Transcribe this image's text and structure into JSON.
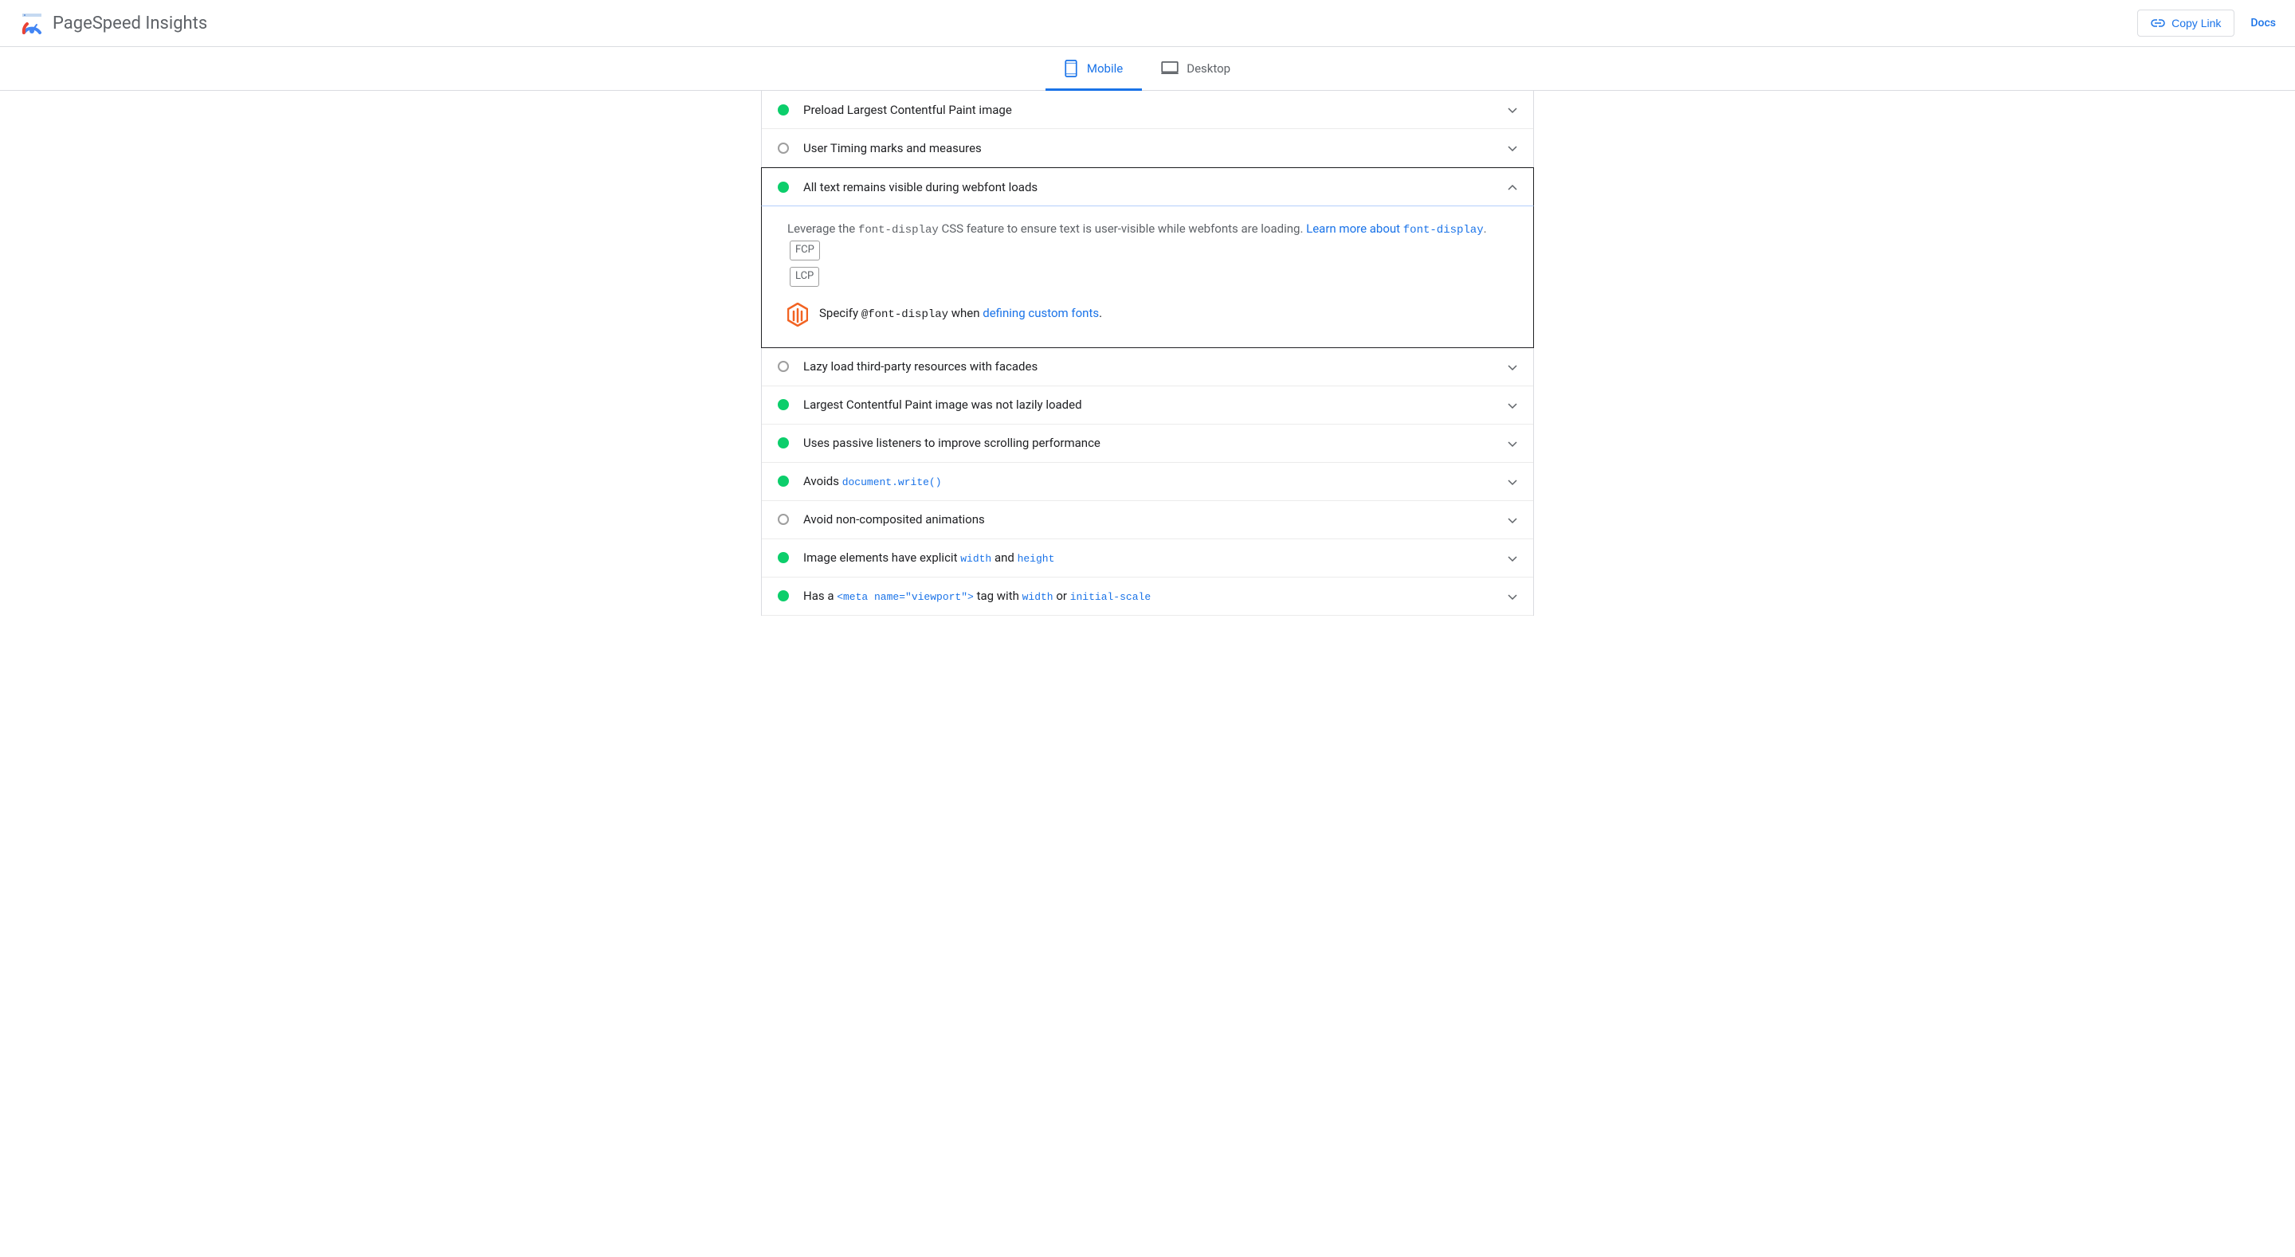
{
  "header": {
    "title": "PageSpeed Insights",
    "copy_link": "Copy Link",
    "docs": "Docs"
  },
  "tabs": {
    "mobile": "Mobile",
    "desktop": "Desktop"
  },
  "audits": [
    {
      "status": "pass",
      "title": "Preload Largest Contentful Paint image"
    },
    {
      "status": "neutral",
      "title": "User Timing marks and measures"
    },
    {
      "status": "pass",
      "title": "All text remains visible during webfont loads",
      "expanded": true
    },
    {
      "status": "neutral",
      "title": "Lazy load third-party resources with facades"
    },
    {
      "status": "pass",
      "title": "Largest Contentful Paint image was not lazily loaded"
    },
    {
      "status": "pass",
      "title": "Uses passive listeners to improve scrolling performance"
    },
    {
      "status": "pass",
      "title_parts": [
        {
          "t": "Avoids ",
          "c": false
        },
        {
          "t": "document.write()",
          "c": true
        }
      ]
    },
    {
      "status": "neutral",
      "title": "Avoid non-composited animations"
    },
    {
      "status": "pass",
      "title_parts": [
        {
          "t": "Image elements have explicit ",
          "c": false
        },
        {
          "t": "width",
          "c": true
        },
        {
          "t": " and ",
          "c": false
        },
        {
          "t": "height",
          "c": true
        }
      ]
    },
    {
      "status": "pass",
      "title_parts": [
        {
          "t": "Has a ",
          "c": false
        },
        {
          "t": "<meta name=\"viewport\">",
          "c": true
        },
        {
          "t": " tag with ",
          "c": false
        },
        {
          "t": "width",
          "c": true
        },
        {
          "t": " or ",
          "c": false
        },
        {
          "t": "initial-scale",
          "c": true
        }
      ]
    }
  ],
  "expanded": {
    "desc_pre": "Leverage the ",
    "desc_code": "font-display",
    "desc_post": " CSS feature to ensure text is user-visible while webfonts are loading. ",
    "learn_more_pre": "Learn more about ",
    "learn_more_code": "font-display",
    "badges": [
      "FCP",
      "LCP"
    ],
    "stack_pre": "Specify ",
    "stack_code": "@font-display",
    "stack_mid": " when ",
    "stack_link": "defining custom fonts",
    "stack_post": "."
  }
}
